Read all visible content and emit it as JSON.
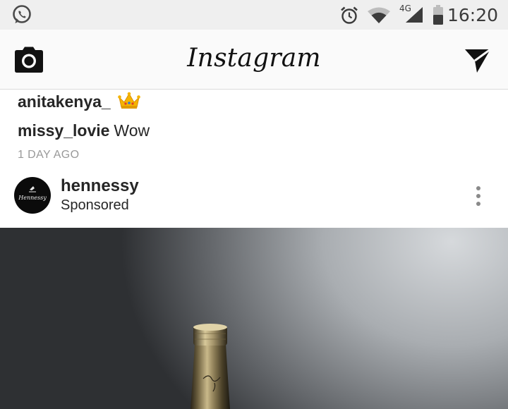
{
  "status_bar": {
    "time": "16:20",
    "network_type": "4G",
    "icons": [
      "whatsapp-icon",
      "alarm-icon",
      "wifi-icon",
      "signal-icon",
      "battery-icon"
    ]
  },
  "top_bar": {
    "logo": "Instagram",
    "icons": [
      "camera-icon",
      "direct-message-icon"
    ]
  },
  "comments": [
    {
      "user": "anitakenya_",
      "text": "",
      "emoji": "crown-emoji"
    },
    {
      "user": "missy_lovie",
      "text": "Wow"
    }
  ],
  "post_time": "1 DAY AGO",
  "post": {
    "username": "hennessy",
    "subtitle": "Sponsored",
    "avatar_brand": "Hennessy",
    "menu_icon": "more-options-icon",
    "image_subject": "bottle"
  },
  "colors": {
    "status_bar_bg": "#efefef",
    "header_bg": "#fafafa",
    "text": "#262626",
    "secondary_text": "#999999"
  }
}
